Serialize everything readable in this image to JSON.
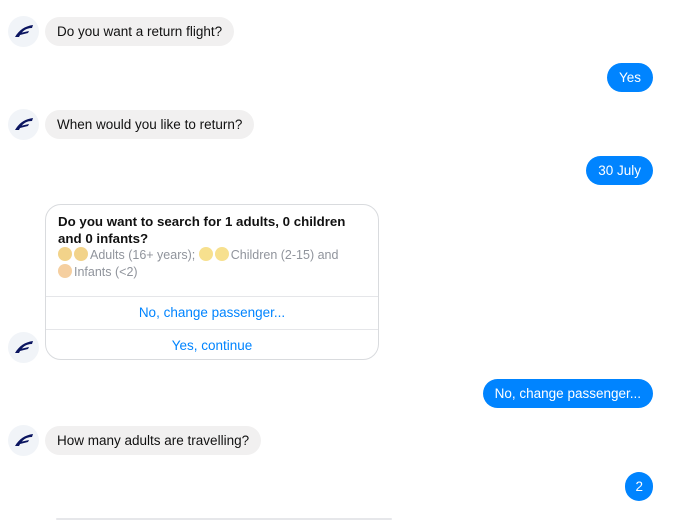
{
  "messages": {
    "q_return_flight": "Do you want a return flight?",
    "a_yes": "Yes",
    "q_return_date": "When would you like to return?",
    "a_date": "30 July",
    "q_adults": "How many adults are travelling?",
    "a_change": "No, change passenger...",
    "a_count": "2"
  },
  "card": {
    "title": "Do you want to search for 1 adults, 0 children and 0 infants?",
    "subtitle_adults": "Adults (16+ years);",
    "subtitle_children": "Children (2-15) and",
    "subtitle_infants": "Infants (<2)",
    "buttons": [
      "No, change passenger...",
      "Yes, continue"
    ]
  },
  "colors": {
    "outgoing_bubble": "#0084ff",
    "incoming_bubble": "#f1f0f0",
    "brand": "#0b1560"
  },
  "icons": {
    "bot_avatar": "finnair-logo-icon",
    "adult": "adult-emoji-icon",
    "child": "child-emoji-icon",
    "infant": "baby-emoji-icon"
  }
}
